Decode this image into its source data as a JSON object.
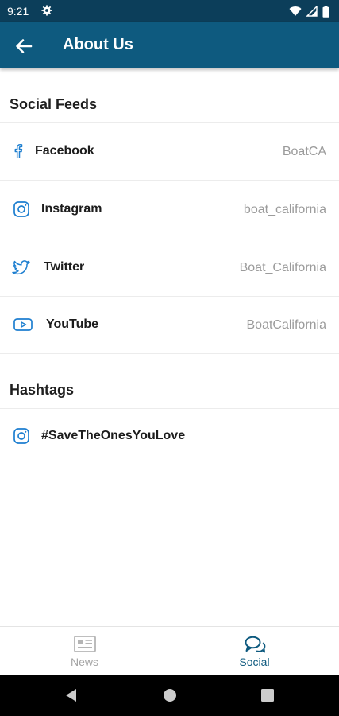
{
  "status_bar": {
    "time": "9:21",
    "icons": [
      "gear-icon",
      "wifi-icon",
      "signal-icon",
      "battery-icon"
    ]
  },
  "app_bar": {
    "title": "About Us",
    "back_icon": "arrow-back-icon"
  },
  "colors": {
    "status_bar": "#0c3e5a",
    "app_bar": "#0e5a7f",
    "accent": "#1e7fd0",
    "muted": "#9b9b9b"
  },
  "social_feeds": {
    "heading": "Social Feeds",
    "items": [
      {
        "icon": "facebook-icon",
        "label": "Facebook",
        "value": "BoatCA"
      },
      {
        "icon": "instagram-icon",
        "label": "Instagram",
        "value": "boat_california"
      },
      {
        "icon": "twitter-icon",
        "label": "Twitter",
        "value": "Boat_California"
      },
      {
        "icon": "youtube-icon",
        "label": "YouTube",
        "value": "BoatCalifornia"
      }
    ]
  },
  "hashtags": {
    "heading": "Hashtags",
    "items": [
      {
        "icon": "instagram-icon",
        "label": "#SaveTheOnesYouLove"
      }
    ]
  },
  "bottom_nav": {
    "items": [
      {
        "icon": "newspaper-icon",
        "label": "News",
        "active": false
      },
      {
        "icon": "chat-bubbles-icon",
        "label": "Social",
        "active": true
      }
    ]
  },
  "system_nav": [
    "back-triangle-icon",
    "home-circle-icon",
    "recents-square-icon"
  ]
}
